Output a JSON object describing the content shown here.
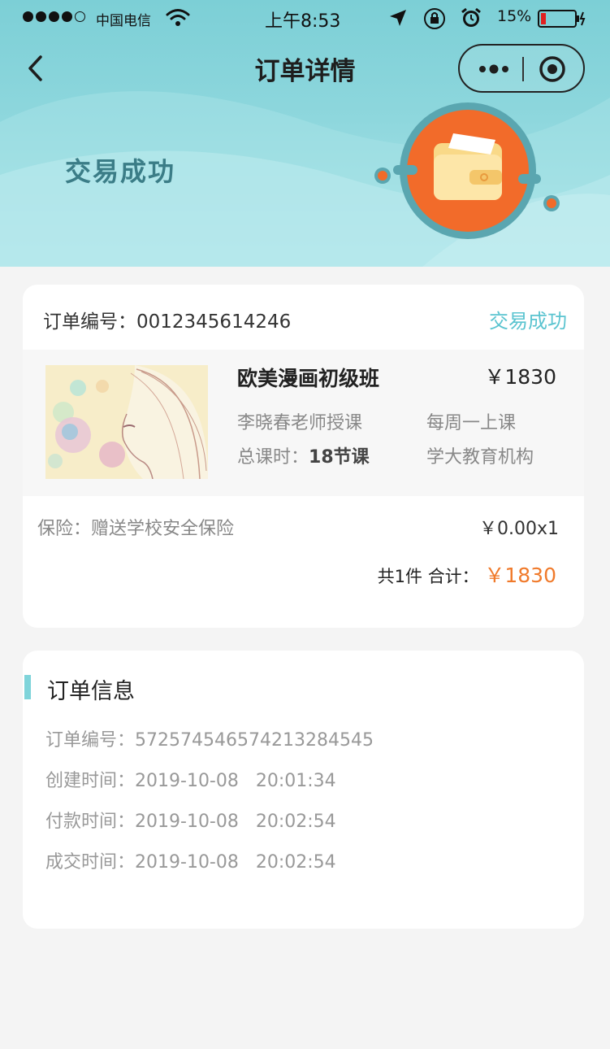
{
  "status_bar": {
    "carrier": "中国电信",
    "time": "上午8:53",
    "battery_percent": "15%",
    "battery_level": 0.15
  },
  "nav": {
    "title": "订单详情",
    "back_icon": "chevron-left-icon",
    "more_icon": "more-dots-icon",
    "close_icon": "target-close-icon"
  },
  "banner": {
    "status": "交易成功",
    "illustration": "wallet-icon"
  },
  "order": {
    "number_label": "订单编号：",
    "number": "0012345614246",
    "status": "交易成功",
    "product": {
      "name": "欧美漫画初级班",
      "price": "￥1830",
      "teacher": "李晓春老师授课",
      "schedule": "每周一上课",
      "hours_label": "总课时：",
      "hours_value": "18节课",
      "organization": "学大教育机构"
    },
    "insurance_label": "保险：",
    "insurance_desc": "赠送学校安全保险",
    "insurance_price": "￥0.00x1",
    "total_count": "共1件",
    "total_label": "合计：",
    "total_amount": "￥1830"
  },
  "info": {
    "title": "订单信息",
    "rows": [
      {
        "label": "订单编号：",
        "value": "572574546574213284545"
      },
      {
        "label": "创建时间：",
        "value": "2019-10-08   20:01:34"
      },
      {
        "label": "付款时间：",
        "value": "2019-10-08   20:02:54"
      },
      {
        "label": "成交时间：",
        "value": "2019-10-08   20:02:54"
      }
    ]
  },
  "colors": {
    "accent": "#5bc4d0",
    "price_highlight": "#f07a2b",
    "header_bg": "#7ccfd6",
    "wallet_orange": "#f26b2a"
  }
}
